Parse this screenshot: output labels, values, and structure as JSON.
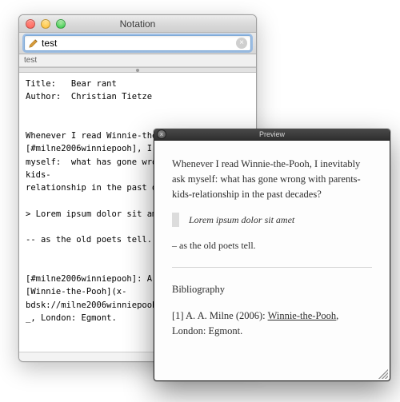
{
  "notation": {
    "title": "Notation",
    "search_value": "test",
    "list_item": "test",
    "editor_text": "Title:   Bear rant\nAuthor:  Christian Tietze\n\n\nWhenever I read Winnie-the-Pooh[Not Cited][#milne2006winniepooh], I inevitably ask\nmyself:  what has gone wrong with parents-kids-\nrelationship in the past decades?\n\n> Lorem ipsum dolor sit amet\n\n-- as the old poets tell.\n\n\n[#milne2006winniepooh]: A. A. Milne (2006):\n[Winnie-the-Pooh](x-bdsk://milne2006winniepooh)\n_, London: Egmont."
  },
  "preview": {
    "title": "Preview",
    "para1": "Whenever I read Winnie-the-Pooh, I inevitably ask myself: what has gone wrong with parents-kids-relationship in the past decades?",
    "quote": "Lorem ipsum dolor sit amet",
    "para2": "– as the old poets tell.",
    "bib_heading": "Bibliography",
    "bib_prefix": "[1] A. A. Milne (2006): ",
    "bib_title": "Winnie-the-Pooh",
    "bib_suffix": ", London: Egmont."
  }
}
